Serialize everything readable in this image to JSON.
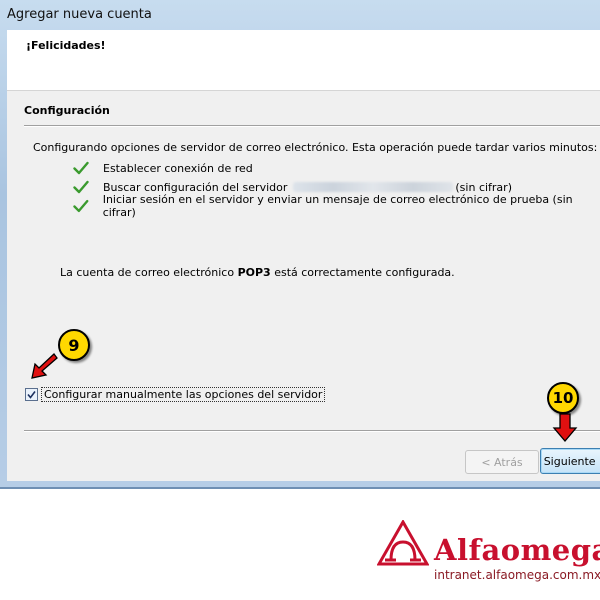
{
  "window": {
    "title": "Agregar nueva cuenta"
  },
  "header": {
    "congrats": "¡Felicidades!"
  },
  "section": {
    "title": "Configuración",
    "lead": "Configurando opciones de servidor de correo electrónico. Esta operación puede tardar varios minutos:",
    "steps": [
      {
        "label": "Establecer conexión de red",
        "icon": "check-icon"
      },
      {
        "label": "Buscar configuración del servidor",
        "suffix": "(sin cifrar)",
        "icon": "check-icon"
      },
      {
        "label": "Iniciar sesión en el servidor y enviar un mensaje de correo electrónico de prueba (sin cifrar)",
        "icon": "check-icon"
      }
    ],
    "success_prefix": "La cuenta de correo electrónico ",
    "success_protocol": "POP3",
    "success_suffix": " está correctamente configurada."
  },
  "manual": {
    "label": "Configurar manualmente las opciones del servidor",
    "checked": true
  },
  "buttons": {
    "back": "< Atrás",
    "next": "Siguiente >"
  },
  "annotations": {
    "badge_a": "9",
    "badge_b": "10"
  },
  "branding": {
    "name": "Alfaomega",
    "domain": "intranet.alfaomega.com.mx"
  },
  "colors": {
    "check": "#3a9a2e",
    "brand": "#c8102e",
    "badge": "#ffd800",
    "arrow": "#e01010"
  }
}
